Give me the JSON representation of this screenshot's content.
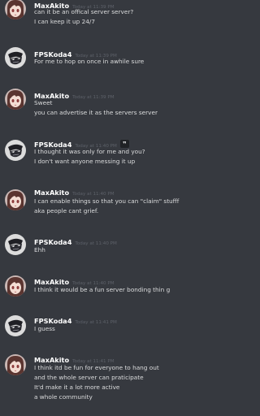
{
  "messages": [
    {
      "author": "MaxAkito",
      "avatar_icon": "anime-girl-avatar-icon",
      "timestamp": "Today at 11:39 PM",
      "lines": [
        "can it be an offical server server?",
        "I can keep it up 24/7"
      ]
    },
    {
      "author": "FPSKoda4",
      "avatar_icon": "masked-face-avatar-icon",
      "timestamp": "Today at 11:39 PM",
      "lines": [
        "For me to hop on once in awhile sure"
      ]
    },
    {
      "author": "MaxAkito",
      "avatar_icon": "anime-girl-avatar-icon",
      "timestamp": "Today at 11:39 PM",
      "lines": [
        "Sweet",
        "you can advertise it as the servers server"
      ]
    },
    {
      "author": "FPSKoda4",
      "avatar_icon": "masked-face-avatar-icon",
      "timestamp": "Today at 11:40 PM",
      "reply_icon": "quote-icon",
      "reply_glyph": "❞",
      "lines": [
        "I thought it was only for me and you?",
        "I don't want anyone messing it up"
      ]
    },
    {
      "author": "MaxAkito",
      "avatar_icon": "anime-girl-avatar-icon",
      "timestamp": "Today at 11:40 PM",
      "lines": [
        "I can enable things so that you can \"claim\" stufff",
        "aka people cant grief."
      ]
    },
    {
      "author": "FPSKoda4",
      "avatar_icon": "masked-face-avatar-icon",
      "timestamp": "Today at 11:40 PM",
      "lines": [
        "Ehh"
      ]
    },
    {
      "author": "MaxAkito",
      "avatar_icon": "anime-girl-avatar-icon",
      "timestamp": "Today at 11:40 PM",
      "lines": [
        "I think it would be a fun server bonding thin g"
      ]
    },
    {
      "author": "FPSKoda4",
      "avatar_icon": "masked-face-avatar-icon",
      "timestamp": "Today at 11:41 PM",
      "lines": [
        "I guess"
      ]
    },
    {
      "author": "MaxAkito",
      "avatar_icon": "anime-girl-avatar-icon",
      "timestamp": "Today at 11:41 PM",
      "lines": [
        "I think itd be fun for everyone to hang out",
        "and the whole server can praticipate",
        "It'd make it a lot more active",
        "a whole community"
      ]
    }
  ],
  "colors": {
    "background": "#36393f",
    "username": "#ffffff",
    "message_text": "#dcddde",
    "timestamp": "#5d6169"
  }
}
